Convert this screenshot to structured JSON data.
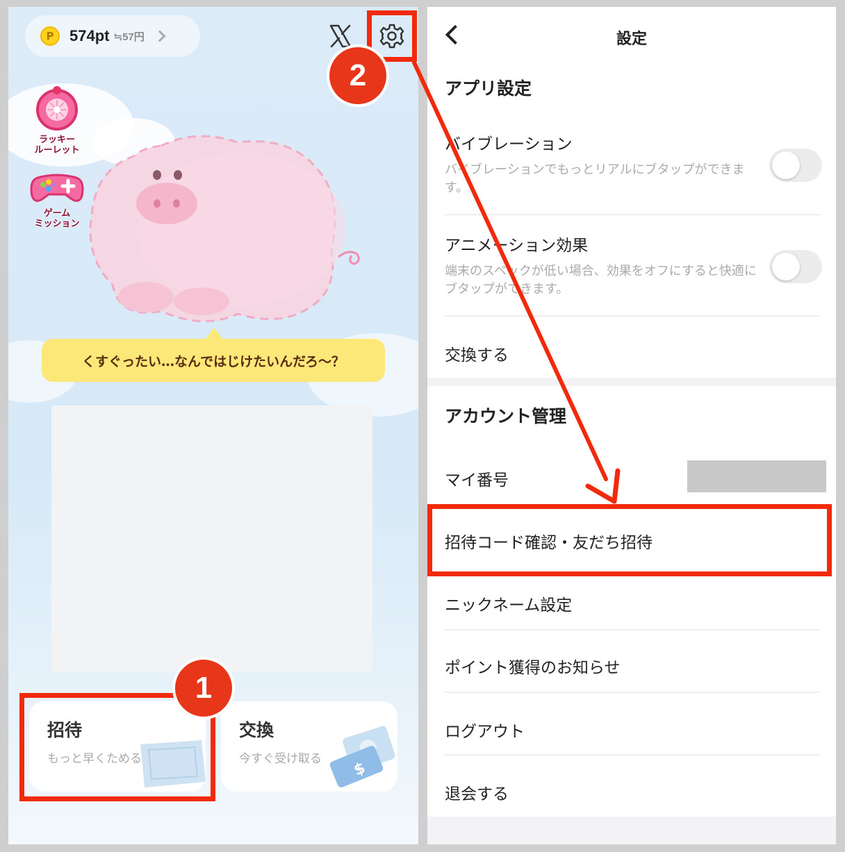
{
  "left_screen": {
    "points": {
      "coin_symbol": "P",
      "value": "574pt",
      "yen": "≒57円"
    },
    "side_icons": [
      {
        "label": "ラッキー\nルーレット",
        "icon": "roulette-icon"
      },
      {
        "label": "ゲーム\nミッション",
        "icon": "gamepad-icon"
      }
    ],
    "speech_bubble": "くすぐったい…なんではじけたいんだろ～？",
    "cards": [
      {
        "title": "招待",
        "subtitle": "もっと早くためる"
      },
      {
        "title": "交換",
        "subtitle": "今すぐ受け取る"
      }
    ]
  },
  "annotations": {
    "step1": "1",
    "step2": "2",
    "highlight_color": "#f22a0c"
  },
  "settings": {
    "title": "設定",
    "app_section": "アプリ設定",
    "vibration": {
      "label": "バイブレーション",
      "desc": "バイブレーションでもっとリアルにブタップができます。",
      "enabled": false
    },
    "animation": {
      "label": "アニメーション効果",
      "desc": "端末のスペックが低い場合、効果をオフにすると快適にブタップができます。",
      "enabled": false
    },
    "exchange": "交換する",
    "account_section": "アカウント管理",
    "my_number": "マイ番号",
    "invite": "招待コード確認・友だち招待",
    "nickname": "ニックネーム設定",
    "notify": "ポイント獲得のお知らせ",
    "logout": "ログアウト",
    "withdraw": "退会する"
  }
}
